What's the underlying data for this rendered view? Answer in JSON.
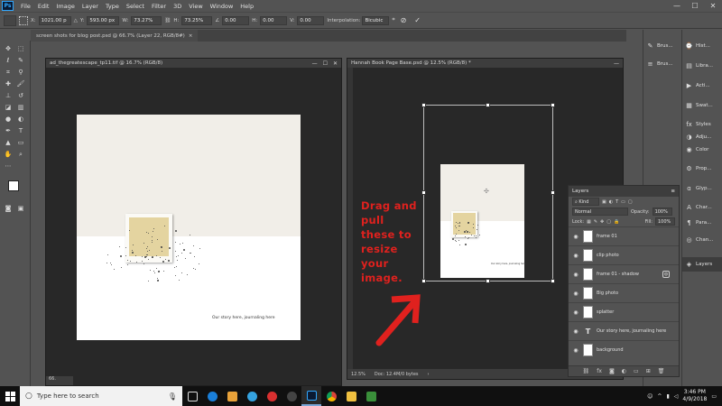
{
  "menubar": {
    "app_logo": "Ps",
    "items": [
      "File",
      "Edit",
      "Image",
      "Layer",
      "Type",
      "Select",
      "Filter",
      "3D",
      "View",
      "Window",
      "Help"
    ]
  },
  "window_controls": {
    "minimize": "—",
    "maximize": "☐",
    "close": "✕"
  },
  "options_bar": {
    "x_label": "X:",
    "x_value": "1021.00 p",
    "y_label": "Y:",
    "y_value": "593.00 px",
    "w_label": "W:",
    "w_value": "73.27%",
    "h_label": "H:",
    "h_value": "73.25%",
    "angle_value": "0.00",
    "hskew_label": "H:",
    "hskew_value": "0.00",
    "vskew_label": "V:",
    "vskew_value": "0.00",
    "interp_label": "Interpolation:",
    "interp_value": "Bicubic",
    "cancel_symbol": "⃠",
    "commit_symbol": "✓"
  },
  "tabs": [
    {
      "label": "screen shots for blog post.psd @ 66.7% (Layer 22, RGB/8#)",
      "close": "×"
    }
  ],
  "doc_left": {
    "title": "ad_thegreatescape_tp11.tif @ 16.7% (RGB/8)",
    "journal": "Our story here, journaling here",
    "zoom": "66."
  },
  "doc_right": {
    "title": "Hannah Book Page Base.psd @ 12.5% (RGB/8) *",
    "journal": "Our story here, journaling here",
    "zoom": "12.5%",
    "doc_info": "Doc: 12.4M/0 bytes"
  },
  "annotation": {
    "lines": [
      "Drag and",
      "pull",
      "these to",
      "resize",
      "your",
      "image."
    ],
    "color": "#e0211e"
  },
  "right_panels_col1": [
    {
      "icon": "brush-icon",
      "label": "Brus..."
    },
    {
      "icon": "brush-presets-icon",
      "label": "Brus..."
    }
  ],
  "right_panels_col2": [
    {
      "icon": "history-icon",
      "label": "Hist..."
    },
    {
      "icon": "libraries-icon",
      "label": "Libra..."
    },
    {
      "icon": "actions-icon",
      "label": "Acti..."
    },
    {
      "icon": "swatches-icon",
      "label": "Swat..."
    },
    {
      "icon": "styles-icon",
      "label": "Styles"
    },
    {
      "icon": "adjustments-icon",
      "label": "Adju..."
    },
    {
      "icon": "color-icon",
      "label": "Color"
    },
    {
      "icon": "properties-icon",
      "label": "Prop..."
    },
    {
      "icon": "glyphs-icon",
      "label": "Glyp..."
    },
    {
      "icon": "character-icon",
      "label": "Char..."
    },
    {
      "icon": "paragraph-icon",
      "label": "Para..."
    },
    {
      "icon": "channels-icon",
      "label": "Chan..."
    },
    {
      "icon": "layers-icon",
      "label": "Layers"
    }
  ],
  "layers_panel": {
    "title": "Layers",
    "kind_label": "Kind",
    "blend_mode": "Normal",
    "opacity_label": "Opacity:",
    "opacity_value": "100%",
    "lock_label": "Lock:",
    "fill_label": "Fill:",
    "fill_value": "100%",
    "layers": [
      {
        "name": "frame 01",
        "thumb": ""
      },
      {
        "name": "clip photo",
        "thumb": ""
      },
      {
        "name": "frame 01 - shadow",
        "thumb": ""
      },
      {
        "name": "Big photo",
        "thumb": ""
      },
      {
        "name": "splatter",
        "thumb": ""
      },
      {
        "name": "Our story here, journaling here",
        "thumb": "T"
      },
      {
        "name": "background",
        "thumb": ""
      }
    ]
  },
  "taskbar": {
    "search_placeholder": "Type here to search",
    "time": "3:46 PM",
    "date": "4/9/2018"
  }
}
